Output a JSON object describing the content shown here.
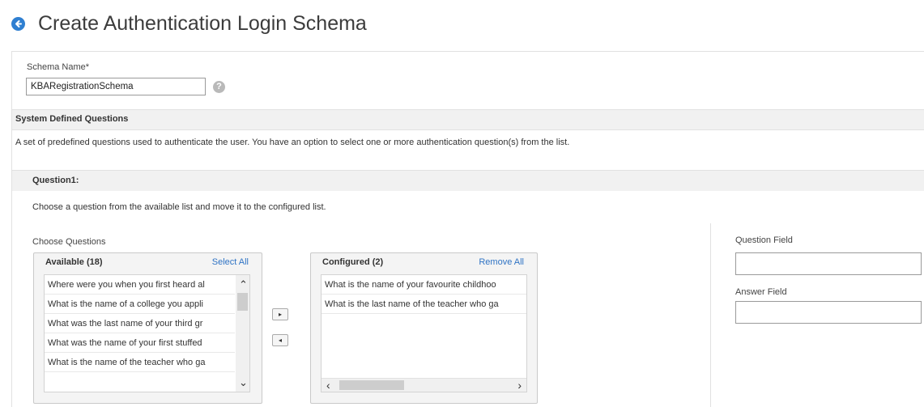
{
  "page": {
    "title": "Create Authentication Login Schema"
  },
  "schema": {
    "label": "Schema Name*",
    "value": "KBARegistrationSchema",
    "help": "?"
  },
  "system_questions": {
    "title": "System Defined Questions",
    "description": "A set of predefined questions used to authenticate the user. You have an option to select one or more authentication question(s) from the list."
  },
  "question": {
    "title": "Question1:",
    "description": "Choose a question from the available list and move it to the configured list.",
    "choose_label": "Choose Questions"
  },
  "available": {
    "title": "Available (18)",
    "link": "Select All",
    "items": [
      "Where were you when you first heard al",
      "What is the name of a college you appli",
      "What was the last name of your third gr",
      "What was the name of your first stuffed",
      "What is the name of the teacher who ga"
    ]
  },
  "configured": {
    "title": "Configured (2)",
    "link": "Remove All",
    "items": [
      "What is the name of your favourite childhoo",
      "What is the last name of the teacher who ga"
    ]
  },
  "move": {
    "add": "▸",
    "remove": "◂"
  },
  "fields": {
    "question_label": "Question Field",
    "answer_label": "Answer Field"
  },
  "scroll": {
    "up": "⌃",
    "down": "⌄",
    "left": "‹",
    "right": "›"
  }
}
